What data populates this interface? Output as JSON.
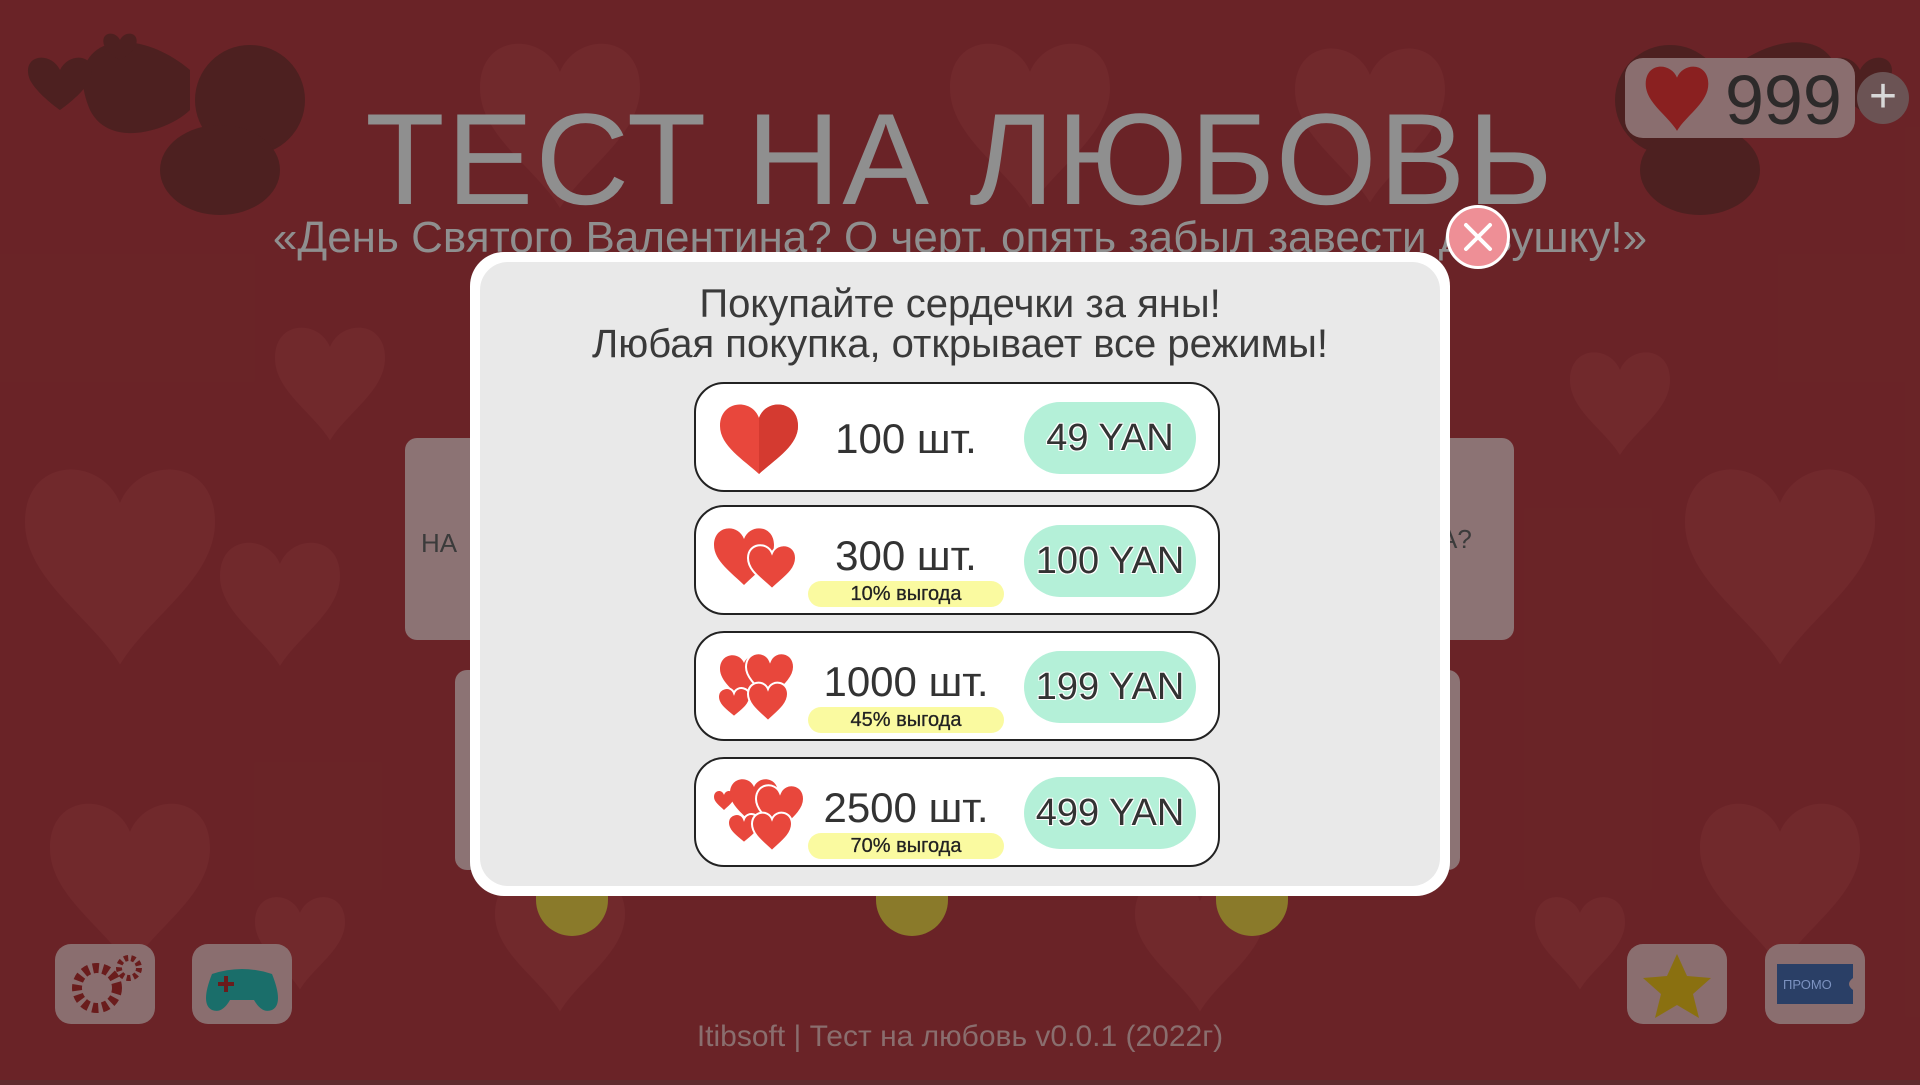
{
  "screen": {
    "title": "ТЕСТ НА ЛЮБОВЬ",
    "subtitle": "«День Святого Валентина? О черт, опять забыл завести девушку!»",
    "hearts_count": "999",
    "plus_label": "+",
    "mode_left_label": "НА",
    "mode_right_label": "А?",
    "promo_label": "ПРОМО",
    "footer": "Itibsoft | Тест на любовь v0.0.1 (2022г)"
  },
  "dialog": {
    "line1": "Покупайте сердечки за яны!",
    "line2": "Любая покупка, открывает все режимы!",
    "offers": [
      {
        "amount": "100 шт.",
        "bonus": "",
        "price": "49 YAN",
        "hearts_icon": "one-heart-icon"
      },
      {
        "amount": "300 шт.",
        "bonus": "10% выгода",
        "price": "100 YAN",
        "hearts_icon": "two-hearts-icon"
      },
      {
        "amount": "1000 шт.",
        "bonus": "45% выгода",
        "price": "199 YAN",
        "hearts_icon": "four-hearts-icon"
      },
      {
        "amount": "2500 шт.",
        "bonus": "70% выгода",
        "price": "499 YAN",
        "hearts_icon": "many-hearts-icon"
      }
    ]
  },
  "colors": {
    "heart_red": "#e8473c",
    "price_mint": "#b4f0d8",
    "bonus_yellow": "#fafaa0",
    "close_pink": "#ee8f96"
  }
}
